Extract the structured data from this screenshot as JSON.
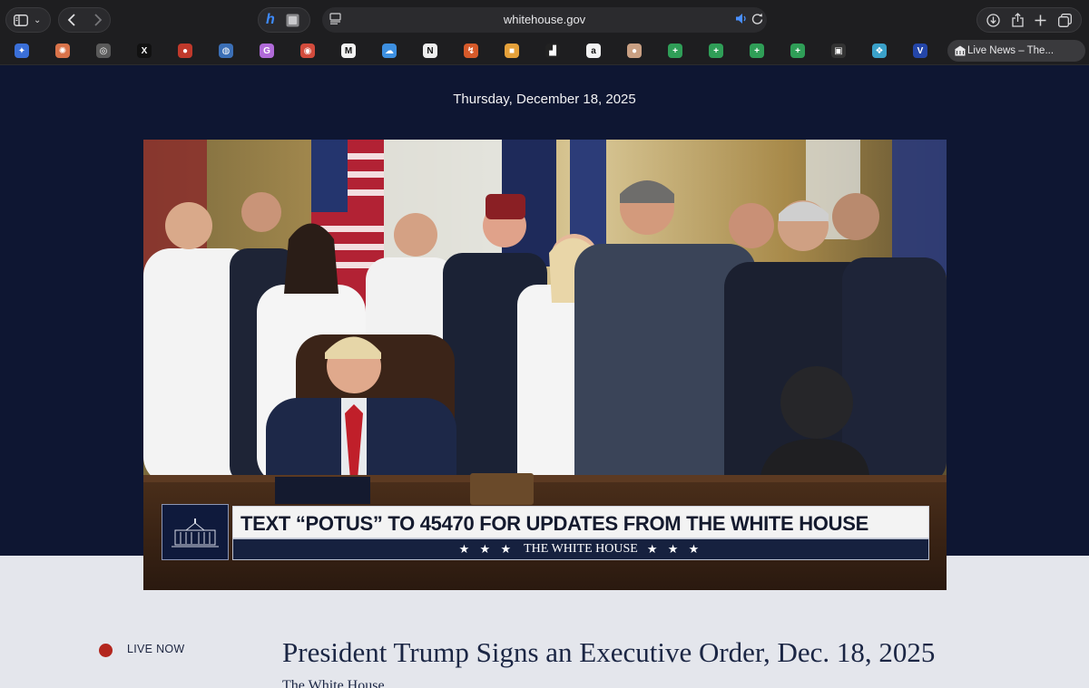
{
  "browser": {
    "url": "whitehouse.gov",
    "active_tab_title": "Live News – The...",
    "favorites": [
      {
        "icon": "sparkle-icon",
        "color": "#3a6fd8",
        "glyph": "✦"
      },
      {
        "icon": "claude-icon",
        "color": "#d9734a",
        "glyph": "✺"
      },
      {
        "icon": "openai-icon",
        "color": "#5a5a5a",
        "glyph": "◎"
      },
      {
        "icon": "x-icon",
        "color": "#111111",
        "glyph": "X"
      },
      {
        "icon": "red-circle-icon",
        "color": "#c0392b",
        "glyph": "●"
      },
      {
        "icon": "globe-icon",
        "color": "#3b6fb6",
        "glyph": "◍"
      },
      {
        "icon": "g-icon",
        "color": "#b06ad8",
        "glyph": "G"
      },
      {
        "icon": "target-icon",
        "color": "#d24b3c",
        "glyph": "◉"
      },
      {
        "icon": "m-icon",
        "color": "#f2f2f2",
        "glyph": "M"
      },
      {
        "icon": "cloud-icon",
        "color": "#3d8fe0",
        "glyph": "☁"
      },
      {
        "icon": "notion-icon",
        "color": "#eeeeee",
        "glyph": "N"
      },
      {
        "icon": "bird-icon",
        "color": "#d65a2a",
        "glyph": "↯"
      },
      {
        "icon": "square-orange-icon",
        "color": "#e5a13a",
        "glyph": "■"
      },
      {
        "icon": "dark-square-icon",
        "color": "#222222",
        "glyph": "▟"
      },
      {
        "icon": "amazon-icon",
        "color": "#f2f2f2",
        "glyph": "a"
      },
      {
        "icon": "avatar-icon",
        "color": "#c9a083",
        "glyph": "●"
      },
      {
        "icon": "sheets-icon",
        "color": "#2f9e57",
        "glyph": "+"
      },
      {
        "icon": "sheets-icon",
        "color": "#2f9e57",
        "glyph": "+"
      },
      {
        "icon": "sheets-icon",
        "color": "#2f9e57",
        "glyph": "+"
      },
      {
        "icon": "sheets-icon",
        "color": "#2f9e57",
        "glyph": "+"
      },
      {
        "icon": "photo-icon",
        "color": "#333333",
        "glyph": "▣"
      },
      {
        "icon": "puzzle-icon",
        "color": "#3aa1c9",
        "glyph": "❖"
      },
      {
        "icon": "v-icon",
        "color": "#2446a8",
        "glyph": "V"
      }
    ]
  },
  "page": {
    "date": "Thursday, December 18, 2025",
    "banner_main": "TEXT “POTUS” TO 45470 FOR UPDATES FROM THE WHITE HOUSE",
    "banner_sub": "THE WHITE HOUSE",
    "banner_stars": "★ ★ ★",
    "live_label": "LIVE NOW",
    "headline": "President Trump Signs an Executive Order, Dec. 18, 2025",
    "byline": "The White House"
  },
  "colors": {
    "page_dark": "#0e1632",
    "page_light": "#e4e6ec",
    "live_red": "#b3261e",
    "headline": "#1b2644"
  }
}
